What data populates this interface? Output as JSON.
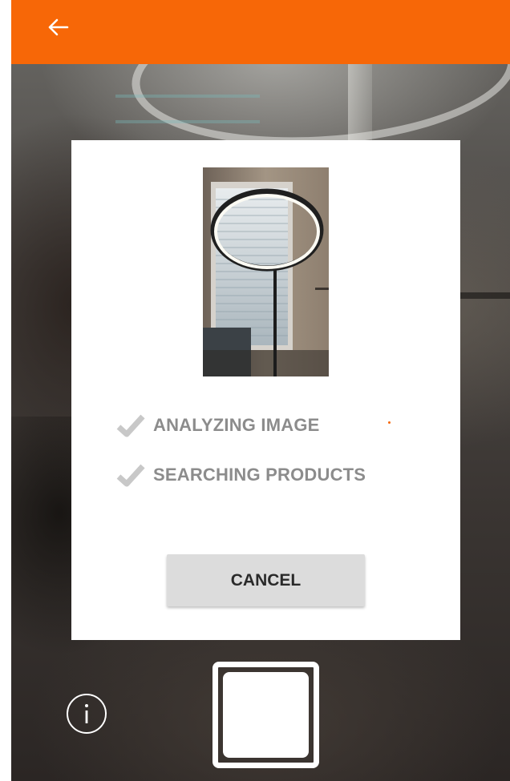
{
  "header": {
    "back_icon": "arrow-left-icon",
    "background_color": "#f76707"
  },
  "dialog": {
    "thumbnail_alt": "captured photo",
    "steps": [
      {
        "label": "ANALYZING IMAGE",
        "status": "done"
      },
      {
        "label": "SEARCHING PRODUCTS",
        "status": "done"
      }
    ],
    "cancel_label": "CANCEL"
  },
  "camera_controls": {
    "info_icon": "info-icon",
    "shutter_icon": "shutter-button"
  },
  "colors": {
    "accent": "#f76707",
    "check": "#c8c8c8",
    "step_text": "#8c8c8c",
    "button_bg": "#dcdcdc"
  }
}
